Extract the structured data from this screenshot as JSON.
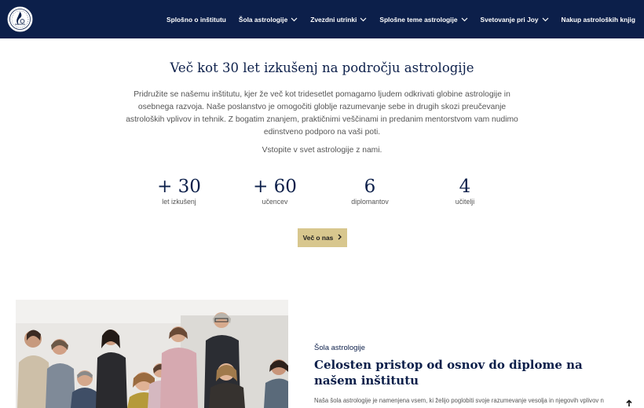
{
  "nav": {
    "logo_icon": "zodiac-seal-logo-icon",
    "items": [
      {
        "label": "Splošno o inštitutu",
        "dropdown": false
      },
      {
        "label": "Šola astrologije",
        "dropdown": true
      },
      {
        "label": "Zvezdni utrinki",
        "dropdown": true
      },
      {
        "label": "Splošne teme astrologije",
        "dropdown": true
      },
      {
        "label": "Svetovanje pri Joy",
        "dropdown": true
      },
      {
        "label": "Nakup astroloških knjig",
        "dropdown": false
      }
    ]
  },
  "hero": {
    "title": "Več kot 30 let izkušenj na področju astrologije",
    "text": "Pridružite se našemu inštitutu, kjer že več kot tridesetlet pomagamo ljudem odkrivati globine astrologije in osebnega razvoja. Naše poslanstvo je omogočiti globlje razumevanje sebe in drugih skozi preučevanje astroloških vplivov in tehnik. Z bogatim znanjem, praktičnimi veščinami in predanim mentorstvom vam nudimo edinstveno podporo na vaši poti.",
    "subtext": "Vstopite v svet astrologije z nami.",
    "button_label": "Več o nas",
    "button_icon": "chevron-right-icon"
  },
  "stats": [
    {
      "value": "+ 30",
      "label": "let izkušenj"
    },
    {
      "value": "+ 60",
      "label": "učencev"
    },
    {
      "value": "6",
      "label": "diplomantov"
    },
    {
      "value": "4",
      "label": "učitelji"
    }
  ],
  "school": {
    "kicker": "Šola astrologije",
    "title": "Celosten pristop od osnov do diplome na našem inštitutu",
    "text": "Naša šola astrologije je namenjena vsem, ki želijo poglobiti svoje razumevanje vesolja in njegovih vplivov n",
    "photo_icon": "group-photo-image"
  },
  "scroll_top_icon": "arrow-up-icon",
  "colors": {
    "navy": "#0c1f4a",
    "gold": "#d8c78e",
    "text": "#555555"
  }
}
